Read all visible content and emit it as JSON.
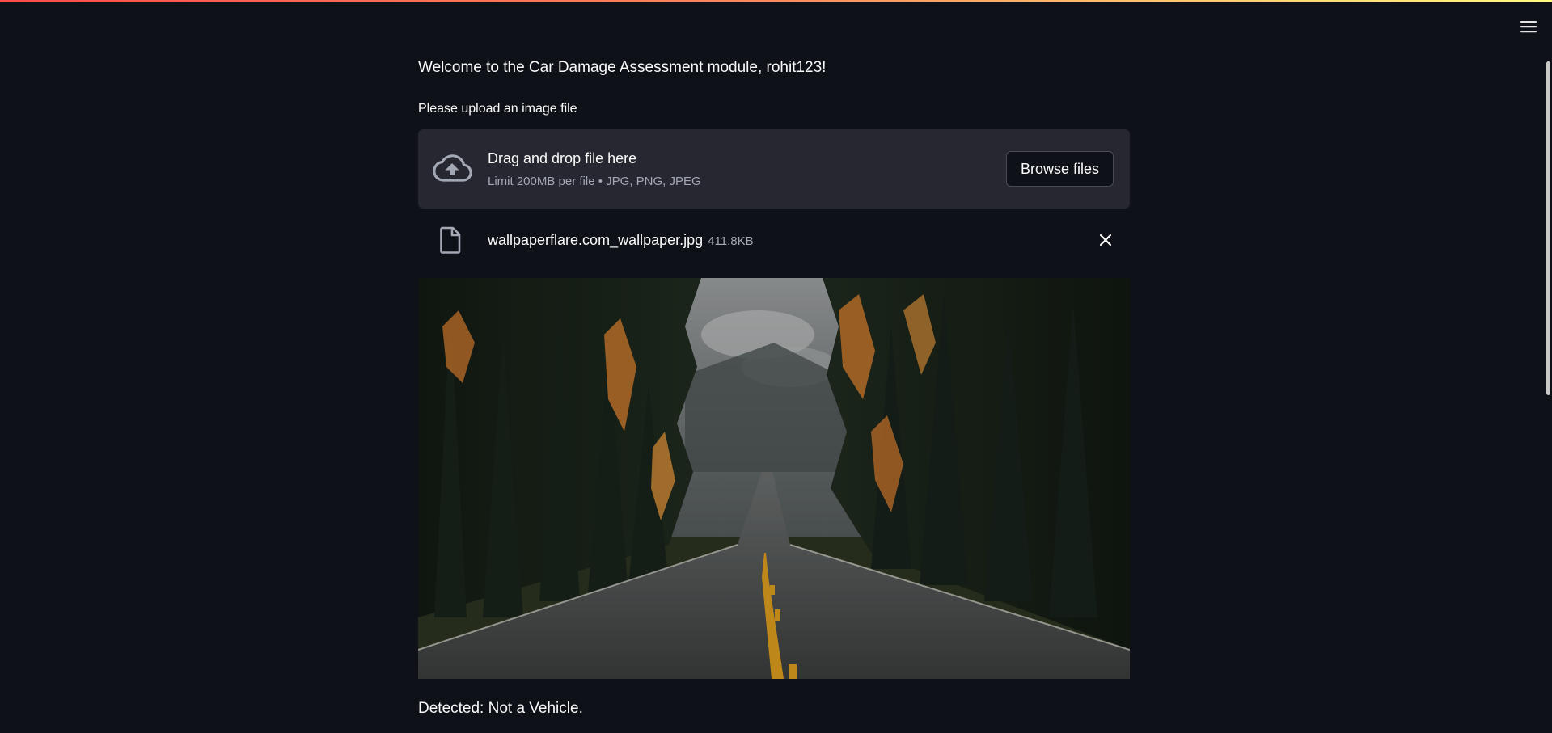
{
  "app": {
    "menu_icon": "hamburger-menu-icon",
    "accent_gradient": [
      "#ff4b4b",
      "#ff8c5a",
      "#fffd80"
    ],
    "background": "#0e1117"
  },
  "main": {
    "welcome_text": "Welcome to the Car Damage Assessment module, rohit123!",
    "upload_label": "Please upload an image file",
    "dropzone": {
      "icon": "cloud-upload-icon",
      "title": "Drag and drop file here",
      "subtitle": "Limit 200MB per file • JPG, PNG, JPEG",
      "browse_label": "Browse files"
    },
    "uploaded_file": {
      "icon": "file-icon",
      "name": "wallpaperflare.com_wallpaper.jpg",
      "size": "411.8KB",
      "remove_icon": "close-icon"
    },
    "image": {
      "description": "forest road with orange-leaved trees and yellow center line"
    },
    "result_text": "Detected: Not a Vehicle."
  }
}
